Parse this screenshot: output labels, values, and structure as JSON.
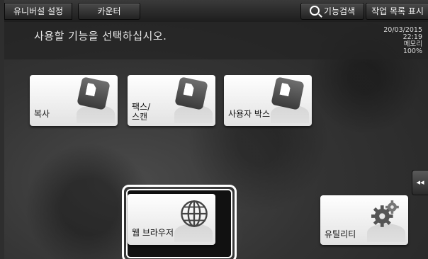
{
  "topbar": {
    "universal_settings": "유니버설 설정",
    "counter": "카운터",
    "search": "기능검색",
    "job_list": "작업 목록 표시"
  },
  "message": "사용할 기능을 선택하십시오.",
  "status": {
    "date": "20/03/2015",
    "time": "22:19",
    "memory_label": "메모리",
    "memory_value": "100%"
  },
  "tiles": {
    "copy": "복사",
    "fax_scan_line1": "팩스/",
    "fax_scan_line2": "스캔",
    "user_box": "사용자 박스",
    "web_browser": "웹 브라우저",
    "utility": "유틸리티"
  },
  "side_tab_icon": "◂◂",
  "icons": [
    "copy-icon",
    "fax-scan-icon",
    "user-box-icon",
    "globe-icon",
    "gear-icon",
    "search-icon"
  ]
}
